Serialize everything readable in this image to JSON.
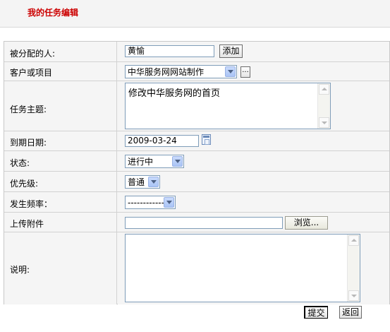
{
  "header": {
    "title": "我的任务编辑"
  },
  "form": {
    "assignee": {
      "label": "被分配的人:",
      "value": "黄愉",
      "add_button": "添加"
    },
    "client": {
      "label": "客户或项目",
      "selected": "中华服务网网站制作",
      "more_button": "..."
    },
    "subject": {
      "label": "任务主题:",
      "value": "修改中华服务网的首页"
    },
    "due_date": {
      "label": "到期日期:",
      "value": "2009-03-24"
    },
    "status": {
      "label": "状态:",
      "selected": "进行中"
    },
    "priority": {
      "label": "优先级:",
      "selected": "普通"
    },
    "frequency": {
      "label": "发生频率：",
      "selected": "------------"
    },
    "attachment": {
      "label": "上传附件",
      "value": "",
      "browse_button": "浏览..."
    },
    "notes": {
      "label": "说明:",
      "value": ""
    }
  },
  "actions": {
    "submit": "提交",
    "back": "返回"
  }
}
